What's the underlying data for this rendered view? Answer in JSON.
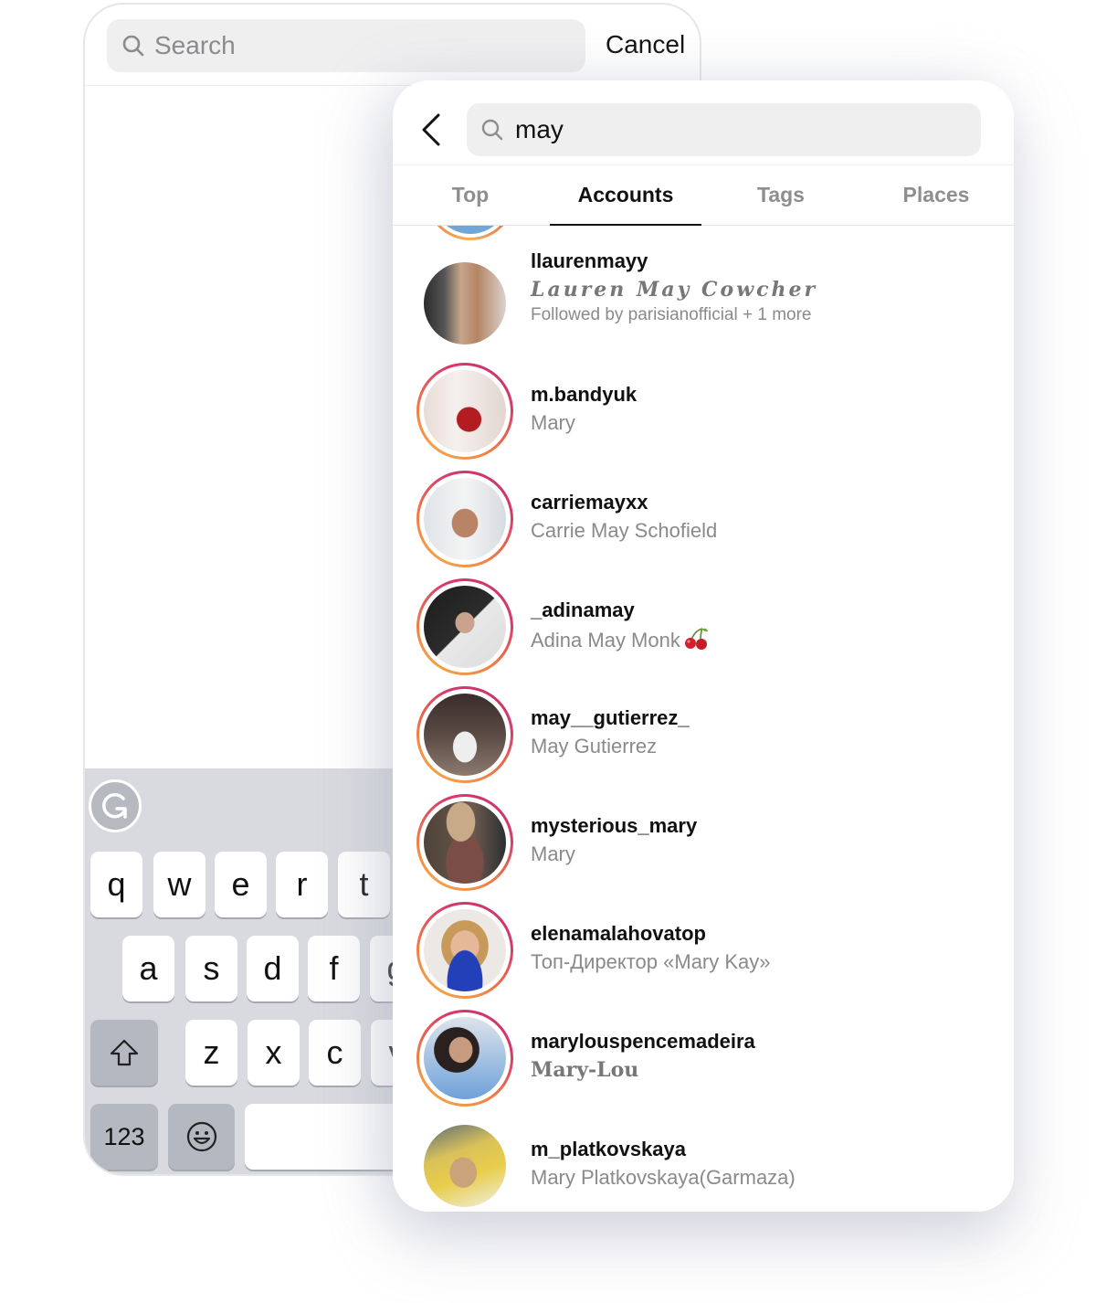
{
  "back_screen": {
    "search": {
      "placeholder": "Search",
      "icon": "search-icon"
    },
    "cancel_label": "Cancel",
    "keyboard": {
      "grammarly_icon": "grammarly-icon",
      "row1": [
        "q",
        "w",
        "e",
        "r",
        "t"
      ],
      "row2": [
        "a",
        "s",
        "d",
        "f",
        "g"
      ],
      "row3": [
        "z",
        "x",
        "c",
        "v"
      ],
      "shift_icon": "shift-icon",
      "numbers_label": "123",
      "emoji_icon": "emoji-icon"
    }
  },
  "front_screen": {
    "back_icon": "chevron-left-icon",
    "search": {
      "value": "may",
      "icon": "search-icon"
    },
    "tabs": [
      {
        "label": "Top",
        "active": false
      },
      {
        "label": "Accounts",
        "active": true
      },
      {
        "label": "Tags",
        "active": false
      },
      {
        "label": "Places",
        "active": false
      }
    ],
    "results": [
      {
        "username": "llaurenmayy",
        "fullname": "Lauren May Cowcher",
        "fullname_style": "script",
        "followed_by": "Followed by parisianofficial + 1 more",
        "story_ring": false
      },
      {
        "username": "m.bandyuk",
        "fullname": "Mary",
        "story_ring": true
      },
      {
        "username": "carriemayxx",
        "fullname": "Carrie May Schofield",
        "story_ring": true
      },
      {
        "username": "_adinamay",
        "fullname": "Adina May Monk",
        "emoji": "🍒",
        "story_ring": true
      },
      {
        "username": "may__gutierrez_",
        "fullname": "May Gutierrez",
        "story_ring": true
      },
      {
        "username": "mysterious_mary",
        "fullname": "Mary",
        "story_ring": true
      },
      {
        "username": "elenamalahovatop",
        "fullname": "Топ-Директор «Mary Kay»",
        "story_ring": true
      },
      {
        "username": "marylouspencemadeira",
        "fullname": "Mary-Lou",
        "fullname_style": "gothic",
        "story_ring": true
      },
      {
        "username": "m_platkovskaya",
        "fullname": "Mary Platkovskaya(Garmaza)",
        "story_ring": false
      }
    ]
  },
  "colors": {
    "story_ring_start": "#f9b54a",
    "story_ring_end": "#c3306f",
    "secondary_text": "#8a8a8a",
    "search_bg": "#efefef",
    "keyboard_bg": "#d9dadf"
  }
}
